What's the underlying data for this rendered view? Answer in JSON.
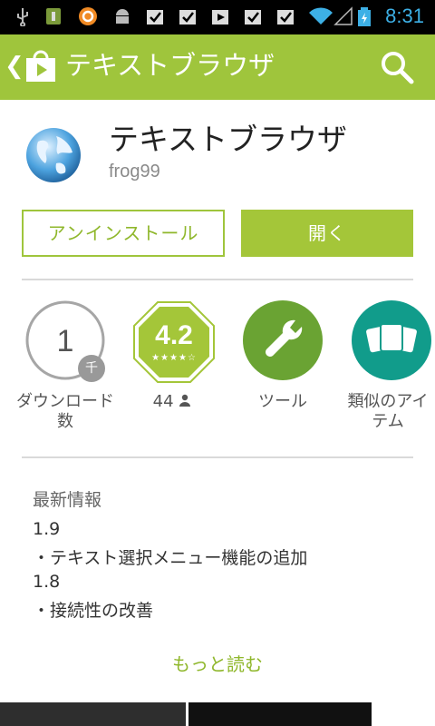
{
  "status_bar": {
    "time": "8:31",
    "icons": [
      "usb-icon",
      "sd-card-icon",
      "app-notify-icon",
      "android-icon",
      "download-done-icon",
      "download-done-icon",
      "play-icon",
      "download-done-icon",
      "download-done-icon",
      "wifi-icon",
      "signal-icon",
      "battery-icon"
    ]
  },
  "app_bar": {
    "title": "テキストブラウザ",
    "back_glyph": "❮"
  },
  "app": {
    "name": "テキストブラウザ",
    "developer": "frog99"
  },
  "buttons": {
    "uninstall": "アンインストール",
    "open": "開く"
  },
  "badges": {
    "downloads": {
      "value": "1",
      "unit": "千",
      "label": "ダウンロード数"
    },
    "rating": {
      "value": "4.2",
      "stars": "★★★★☆",
      "count": "44"
    },
    "category": {
      "label": "ツール"
    },
    "similar": {
      "label": "類似のアイテム"
    }
  },
  "whats_new": {
    "title": "最新情報",
    "lines": [
      "1.9",
      "・テキスト選択メニュー機能の追加",
      "1.8",
      "・接続性の改善"
    ],
    "more": "もっと読む"
  },
  "colors": {
    "accent": "#9fc53c",
    "category_badge": "#6aa333",
    "similar_badge": "#119c8b",
    "time": "#3db0e6"
  }
}
